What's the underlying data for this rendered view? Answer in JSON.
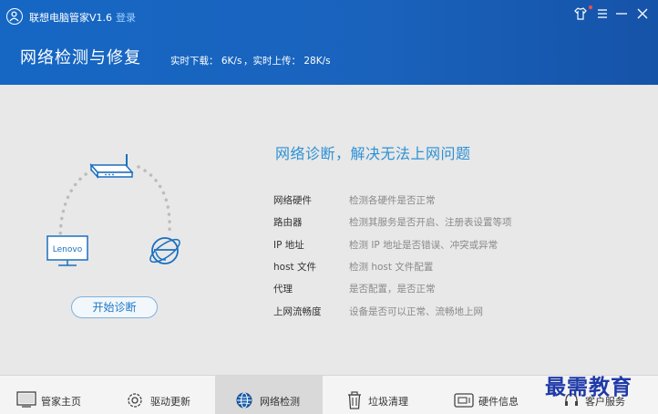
{
  "window": {
    "app_title": "联想电脑管家V1.6",
    "login_label": "登录"
  },
  "header": {
    "page_title": "网络检测与修复",
    "download_speed": "实时下载：  6K/s",
    "upload_speed": "，实时上传：  28K/s"
  },
  "graphic": {
    "monitor_brand": "Lenovo"
  },
  "main": {
    "title": "网络诊断，解决无法上网问题",
    "start_button": "开始诊断",
    "checks": [
      {
        "label": "网络硬件",
        "desc": "检测各硬件是否正常"
      },
      {
        "label": "路由器",
        "desc": "检测其服务是否开启、注册表设置等项"
      },
      {
        "label": "IP 地址",
        "desc": "检测 IP 地址是否错误、冲突或异常"
      },
      {
        "label": "host 文件",
        "desc": "检测 host 文件配置"
      },
      {
        "label": "代理",
        "desc": "是否配置，是否正常"
      },
      {
        "label": "上网流畅度",
        "desc": "设备是否可以正常、流畅地上网"
      }
    ]
  },
  "nav": {
    "items": [
      {
        "label": "管家主页",
        "icon": "monitor-icon"
      },
      {
        "label": "驱动更新",
        "icon": "gear-icon"
      },
      {
        "label": "网络检测",
        "icon": "globe-icon",
        "active": true
      },
      {
        "label": "垃圾清理",
        "icon": "trash-icon"
      },
      {
        "label": "硬件信息",
        "icon": "hardware-icon"
      },
      {
        "label": "客户服务",
        "icon": "headset-icon"
      }
    ]
  },
  "watermark": "最需教育",
  "colors": {
    "header_blue": "#1667c4",
    "accent_blue": "#2c91d6",
    "link_blue": "#9fd2ff",
    "watermark": "#1f3aa8"
  }
}
